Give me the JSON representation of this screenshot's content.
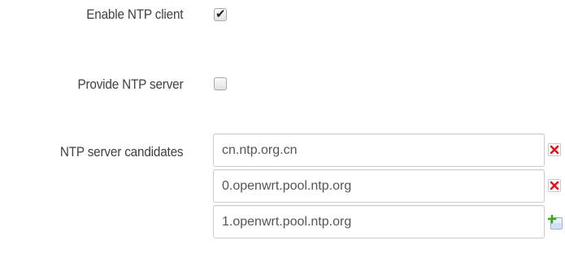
{
  "ntp": {
    "enable_client": {
      "label": "Enable NTP client",
      "checked": true
    },
    "provide_server": {
      "label": "Provide NTP server",
      "checked": false
    },
    "candidates": {
      "label": "NTP server candidates",
      "servers": [
        {
          "value": "cn.ntp.org.cn",
          "action": "remove"
        },
        {
          "value": "0.openwrt.pool.ntp.org",
          "action": "remove"
        },
        {
          "value": "1.openwrt.pool.ntp.org",
          "action": "add"
        }
      ]
    }
  },
  "icons": {
    "remove": "remove-icon",
    "add": "add-icon"
  },
  "colors": {
    "remove_red": "#e0141e",
    "add_green": "#3aa52f",
    "label_text": "#404040",
    "input_text": "#555555"
  }
}
